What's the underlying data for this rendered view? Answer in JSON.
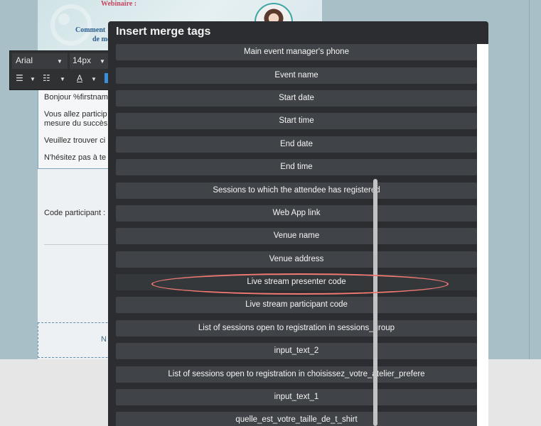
{
  "background": {
    "banner_title": "Webinaire :",
    "banner_text_line1": "Comment",
    "banner_text_line2": "de mo",
    "email_lines": [
      "Bonjour %firstnam",
      "Vous allez particip",
      "mesure du succès",
      "Veuillez trouver ci",
      "N'hésitez pas à te"
    ],
    "participant_code_label": "Code participant :",
    "dashed_box_text": "N"
  },
  "toolbar": {
    "font_family": "Arial",
    "font_size": "14px"
  },
  "dialog": {
    "title": "Insert merge tags",
    "items": [
      "Main event manager's phone",
      "Event name",
      "Start date",
      "Start time",
      "End date",
      "End time",
      "Sessions to which the attendee has registered",
      "Web App link",
      "Venue name",
      "Venue address",
      "Live stream presenter code",
      "Live stream participant code",
      "List of sessions open to registration in sessions_group",
      "input_text_2",
      "List of sessions open to registration in choisissez_votre_atelier_prefere",
      "input_text_1",
      "quelle_est_votre_taille_de_t_shirt"
    ],
    "highlighted_item": "Live stream presenter code",
    "annotation_color": "#f07a73"
  },
  "colors": {
    "dialog_bg": "#2b2d30",
    "item_bg": "#404347",
    "page_bg": "#a9bfc7"
  }
}
